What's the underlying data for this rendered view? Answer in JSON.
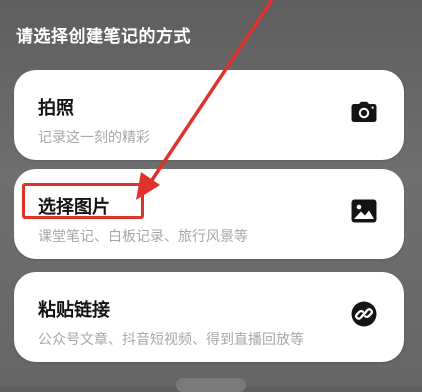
{
  "sheet": {
    "title": "请选择创建笔记的方式"
  },
  "options": [
    {
      "title": "拍照",
      "subtitle": "记录这一刻的精彩",
      "icon": "camera-icon"
    },
    {
      "title": "选择图片",
      "subtitle": "课堂笔记、白板记录、旅行风景等",
      "icon": "image-icon"
    },
    {
      "title": "粘贴链接",
      "subtitle": "公众号文章、抖音短视频、得到直播回放等",
      "icon": "link-icon"
    }
  ],
  "annotation": {
    "color": "#e0312a",
    "target": "选择图片"
  }
}
